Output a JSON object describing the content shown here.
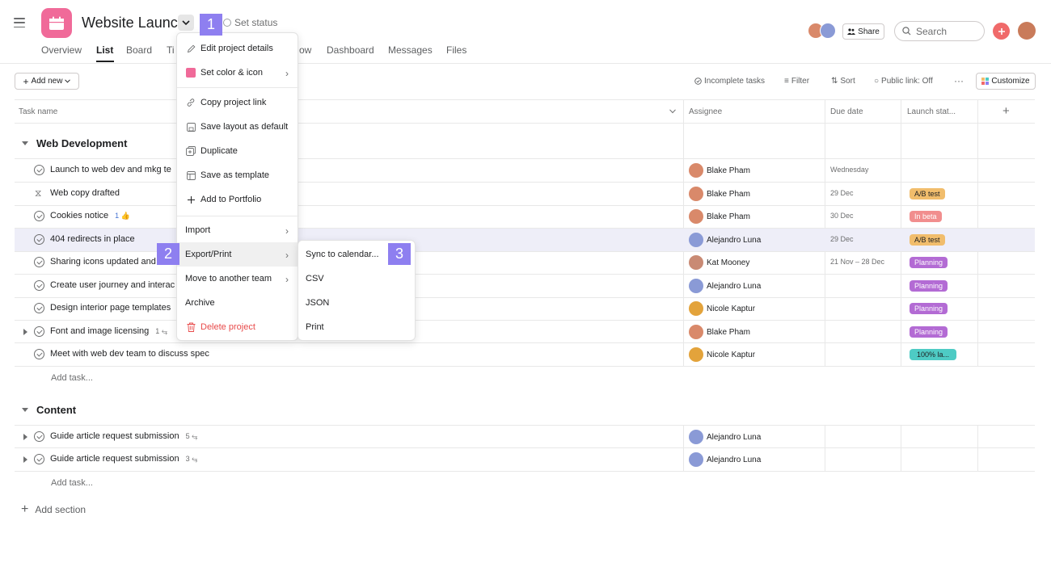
{
  "project": {
    "title": "Website Launch",
    "set_status": "Set status",
    "color": "#f06a99"
  },
  "tabs": [
    "Overview",
    "List",
    "Board",
    "Ti",
    "ow",
    "Dashboard",
    "Messages",
    "Files"
  ],
  "header": {
    "share_label": "Share",
    "search_placeholder": "Search"
  },
  "toolbar": {
    "add_new": "Add new",
    "incomplete_tasks": "Incomplete tasks",
    "filter": "Filter",
    "sort": "Sort",
    "public_link": "Public link: Off",
    "more": "···",
    "customize": "Customize"
  },
  "columns": {
    "task_name": "Task name",
    "assignee": "Assignee",
    "due_date": "Due date",
    "launch_status": "Launch stat...",
    "add": "+"
  },
  "sections": [
    {
      "title": "Web Development",
      "tasks": [
        {
          "name": "Launch to web dev and mkg te",
          "assignee": "Blake Pham",
          "due": "Wednesday",
          "status": ""
        },
        {
          "name": "Web copy drafted",
          "assignee": "Blake Pham",
          "due": "29 Dec",
          "status": "A/B test"
        },
        {
          "name": "Cookies notice",
          "likes": "1",
          "assignee": "Blake Pham",
          "due": "30 Dec",
          "status": "In beta"
        },
        {
          "name": "404 redirects in place",
          "assignee": "Alejandro Luna",
          "due": "29 Dec",
          "status": "A/B test"
        },
        {
          "name": "Sharing icons updated and",
          "assignee": "Kat Mooney",
          "due": "21 Nov – 28 Dec",
          "status": "Planning"
        },
        {
          "name": "Create user journey and interac",
          "assignee": "Alejandro Luna",
          "due": "",
          "status": "Planning"
        },
        {
          "name": "Design interior page templates",
          "assignee": "Nicole Kaptur",
          "due": "",
          "status": "Planning"
        },
        {
          "name": "Font and image licensing",
          "subtasks": "1",
          "assignee": "Blake Pham",
          "due": "",
          "status": "Planning"
        },
        {
          "name": "Meet with web dev team to discuss spec",
          "assignee": "Nicole Kaptur",
          "due": "",
          "status": "100% la..."
        }
      ],
      "add_task": "Add task..."
    },
    {
      "title": "Content",
      "tasks": [
        {
          "name": "Guide article request submission",
          "subtasks": "5",
          "assignee": "Alejandro Luna"
        },
        {
          "name": "Guide article request submission",
          "subtasks": "3",
          "assignee": "Alejandro Luna"
        }
      ],
      "add_task": "Add task..."
    }
  ],
  "add_section": "Add section",
  "status_colors": {
    "A/B test": {
      "bg": "#f1bd6c",
      "fg": "#1e1f21"
    },
    "In beta": {
      "bg": "#f18e8e",
      "fg": "#ffffff"
    },
    "Planning": {
      "bg": "#b36bd4",
      "fg": "#ffffff"
    },
    "100% la...": {
      "bg": "#4ecbc4",
      "fg": "#1e1f21"
    }
  },
  "project_menu": {
    "items": [
      {
        "label": "Edit project details",
        "icon": "pencil-icon"
      },
      {
        "label": "Set color & icon",
        "icon": "color-swatch-icon",
        "submenu": true
      },
      {
        "label": "Copy project link",
        "icon": "link-icon"
      },
      {
        "label": "Save layout as default",
        "icon": "save-layout-icon"
      },
      {
        "label": "Duplicate",
        "icon": "duplicate-icon"
      },
      {
        "label": "Save as template",
        "icon": "template-icon"
      },
      {
        "label": "Add to Portfolio",
        "icon": "plus-icon"
      },
      {
        "label": "Import",
        "submenu": true
      },
      {
        "label": "Export/Print",
        "submenu": true
      },
      {
        "label": "Move to another team",
        "submenu": true
      },
      {
        "label": "Archive"
      },
      {
        "label": "Delete project",
        "icon": "trash-icon",
        "danger": true
      }
    ]
  },
  "export_menu": {
    "items": [
      "Sync to calendar...",
      "CSV",
      "JSON",
      "Print"
    ]
  },
  "callouts": [
    "1",
    "2",
    "3"
  ]
}
